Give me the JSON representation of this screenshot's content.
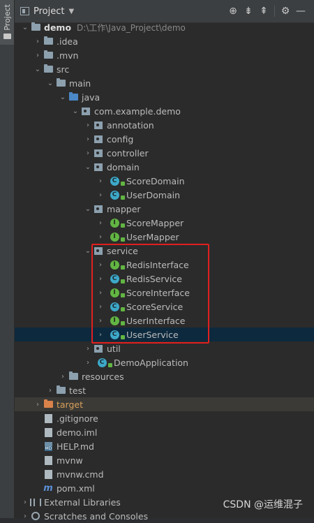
{
  "left_strip": {
    "tab_label": "Project"
  },
  "header": {
    "title": "Project"
  },
  "tree": [
    {
      "label": "demo",
      "path": "D:\\工作\\Java_Project\\demo",
      "depth": 0,
      "arrow": "open",
      "icon": "module-folder",
      "bold": true
    },
    {
      "label": ".idea",
      "depth": 1,
      "arrow": "closed",
      "icon": "folder"
    },
    {
      "label": ".mvn",
      "depth": 1,
      "arrow": "closed",
      "icon": "folder"
    },
    {
      "label": "src",
      "depth": 1,
      "arrow": "open",
      "icon": "folder"
    },
    {
      "label": "main",
      "depth": 2,
      "arrow": "open",
      "icon": "folder"
    },
    {
      "label": "java",
      "depth": 3,
      "arrow": "open",
      "icon": "source-folder"
    },
    {
      "label": "com.example.demo",
      "depth": 4,
      "arrow": "open",
      "icon": "package"
    },
    {
      "label": "annotation",
      "depth": 5,
      "arrow": "closed",
      "icon": "package"
    },
    {
      "label": "config",
      "depth": 5,
      "arrow": "closed",
      "icon": "package"
    },
    {
      "label": "controller",
      "depth": 5,
      "arrow": "closed",
      "icon": "package"
    },
    {
      "label": "domain",
      "depth": 5,
      "arrow": "open",
      "icon": "package"
    },
    {
      "label": "ScoreDomain",
      "depth": 6,
      "arrow": "closed",
      "icon": "class"
    },
    {
      "label": "UserDomain",
      "depth": 6,
      "arrow": "closed",
      "icon": "class"
    },
    {
      "label": "mapper",
      "depth": 5,
      "arrow": "open",
      "icon": "package"
    },
    {
      "label": "ScoreMapper",
      "depth": 6,
      "arrow": "closed",
      "icon": "interface"
    },
    {
      "label": "UserMapper",
      "depth": 6,
      "arrow": "closed",
      "icon": "interface"
    },
    {
      "label": "service",
      "depth": 5,
      "arrow": "open",
      "icon": "package"
    },
    {
      "label": "RedisInterface",
      "depth": 6,
      "arrow": "closed",
      "icon": "interface"
    },
    {
      "label": "RedisService",
      "depth": 6,
      "arrow": "closed",
      "icon": "class"
    },
    {
      "label": "ScoreInterface",
      "depth": 6,
      "arrow": "closed",
      "icon": "interface"
    },
    {
      "label": "ScoreService",
      "depth": 6,
      "arrow": "closed",
      "icon": "class"
    },
    {
      "label": "UserInterface",
      "depth": 6,
      "arrow": "closed",
      "icon": "interface"
    },
    {
      "label": "UserService",
      "depth": 6,
      "arrow": "closed",
      "icon": "class",
      "selected": true
    },
    {
      "label": "util",
      "depth": 5,
      "arrow": "closed",
      "icon": "package"
    },
    {
      "label": "DemoApplication",
      "depth": 5,
      "arrow": "closed",
      "icon": "spring-class"
    },
    {
      "label": "resources",
      "depth": 3,
      "arrow": "closed",
      "icon": "resources-folder"
    },
    {
      "label": "test",
      "depth": 2,
      "arrow": "closed",
      "icon": "folder"
    },
    {
      "label": "target",
      "depth": 1,
      "arrow": "closed",
      "icon": "excluded-folder",
      "excluded": true
    },
    {
      "label": ".gitignore",
      "depth": 1,
      "arrow": "none",
      "icon": "file"
    },
    {
      "label": "demo.iml",
      "depth": 1,
      "arrow": "none",
      "icon": "file"
    },
    {
      "label": "HELP.md",
      "depth": 1,
      "arrow": "none",
      "icon": "md-file"
    },
    {
      "label": "mvnw",
      "depth": 1,
      "arrow": "none",
      "icon": "file"
    },
    {
      "label": "mvnw.cmd",
      "depth": 1,
      "arrow": "none",
      "icon": "file"
    },
    {
      "label": "pom.xml",
      "depth": 1,
      "arrow": "none",
      "icon": "maven-file"
    },
    {
      "label": "External Libraries",
      "depth": 0,
      "arrow": "closed",
      "icon": "libraries"
    },
    {
      "label": "Scratches and Consoles",
      "depth": 0,
      "arrow": "closed",
      "icon": "scratches"
    }
  ],
  "watermark": "CSDN @运维混子"
}
